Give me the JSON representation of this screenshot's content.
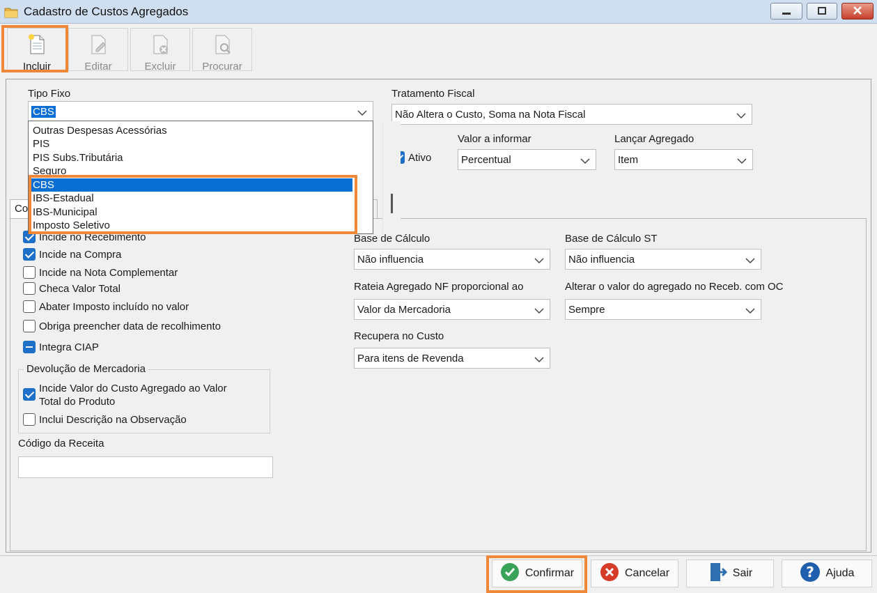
{
  "window": {
    "title": "Cadastro de Custos Agregados",
    "icon": "folder-icon",
    "controls": [
      "minimize-icon",
      "maximize-icon",
      "close-icon"
    ]
  },
  "toolbar": {
    "incluir": "Incluir",
    "editar": "Editar",
    "excluir": "Excluir",
    "procurar": "Procurar"
  },
  "form": {
    "tipo_fixo_label": "Tipo Fixo",
    "tipo_fixo_value": "CBS",
    "tratamento_fiscal_label": "Tratamento Fiscal",
    "tratamento_fiscal_value": "Não Altera o Custo, Soma na Nota Fiscal",
    "ativo_label": "Ativo",
    "ativo_checked": true,
    "valor_informar_label": "Valor a informar",
    "valor_informar_value": "Percentual",
    "lancar_agregado_label": "Lançar Agregado",
    "lancar_agregado_value": "Item"
  },
  "dropdown": {
    "items": [
      "Outras Despesas Acessórias",
      "PIS",
      "PIS Subs.Tributária",
      "Seguro",
      "CBS",
      "IBS-Estadual",
      "IBS-Municipal",
      "Imposto Seletivo"
    ],
    "selected": "CBS"
  },
  "tab": {
    "first_label": "Co"
  },
  "checks": {
    "incide_recebimento": "Incide no Recebimento",
    "incide_compra": "Incide na Compra",
    "incide_nota_complementar": "Incide na Nota Complementar",
    "checa_valor_total": "Checa Valor Total",
    "abater_imposto": "Abater Imposto incluído no valor",
    "obriga_data": "Obriga preencher data de recolhimento",
    "integra_ciap": "Integra CIAP"
  },
  "devolucao": {
    "title": "Devolução de Mercadoria",
    "incide_valor_line1": "Incide Valor do Custo Agregado ao Valor",
    "incide_valor_line2": "Total do Produto",
    "inclui_descricao": "Inclui Descrição na Observação"
  },
  "codigo_receita": {
    "label": "Código da Receita",
    "value": ""
  },
  "right": {
    "base_calculo_label": "Base de Cálculo",
    "base_calculo_value": "Não influencia",
    "base_calculo_st_label": "Base de Cálculo ST",
    "base_calculo_st_value": "Não influencia",
    "rateia_label": "Rateia Agregado NF proporcional ao",
    "rateia_value": "Valor da Mercadoria",
    "alterar_label": "Alterar o valor do agregado no Receb. com OC",
    "alterar_value": "Sempre",
    "recupera_label": "Recupera no Custo",
    "recupera_value": "Para itens de Revenda"
  },
  "buttons": {
    "confirmar": "Confirmar",
    "cancelar": "Cancelar",
    "sair": "Sair",
    "ajuda": "Ajuda"
  },
  "colors": {
    "highlight": "#f0883a",
    "selection": "#0a6fd4",
    "check": "#1e6fc8"
  }
}
